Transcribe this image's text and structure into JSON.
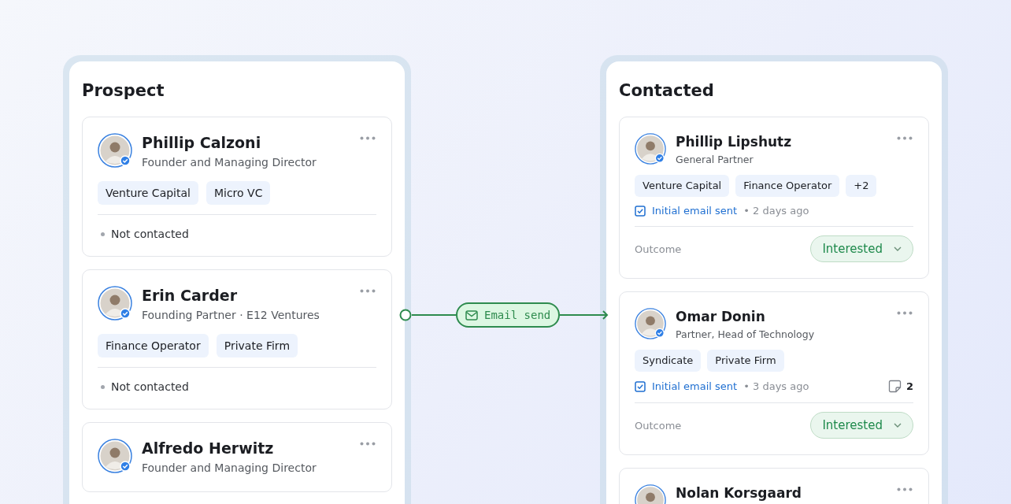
{
  "columns": [
    {
      "title": "Prospect",
      "cards": [
        {
          "name": "Phillip Calzoni",
          "role": "Founder and Managing Director",
          "tags": [
            "Venture Capital",
            "Micro VC"
          ],
          "status": "Not contacted"
        },
        {
          "name": "Erin Carder",
          "role": "Founding Partner · E12 Ventures",
          "tags": [
            "Finance Operator",
            "Private Firm"
          ],
          "status": "Not contacted"
        },
        {
          "name": "Alfredo Herwitz",
          "role": "Founder and Managing Director"
        }
      ]
    },
    {
      "title": "Contacted",
      "cards": [
        {
          "name": "Phillip Lipshutz",
          "role": "General Partner",
          "tags": [
            "Venture Capital",
            "Finance Operator",
            "+2"
          ],
          "activity": "Initial email sent",
          "time": "• 2 days ago",
          "outcome_label": "Outcome",
          "outcome": "Interested"
        },
        {
          "name": "Omar Donin",
          "role": "Partner, Head of Technology",
          "tags": [
            "Syndicate",
            "Private Firm"
          ],
          "activity": "Initial email sent",
          "time": "• 3 days ago",
          "notes": "2",
          "outcome_label": "Outcome",
          "outcome": "Interested"
        },
        {
          "name": "Nolan Korsgaard"
        }
      ]
    }
  ],
  "connector": {
    "label": "Email send"
  }
}
